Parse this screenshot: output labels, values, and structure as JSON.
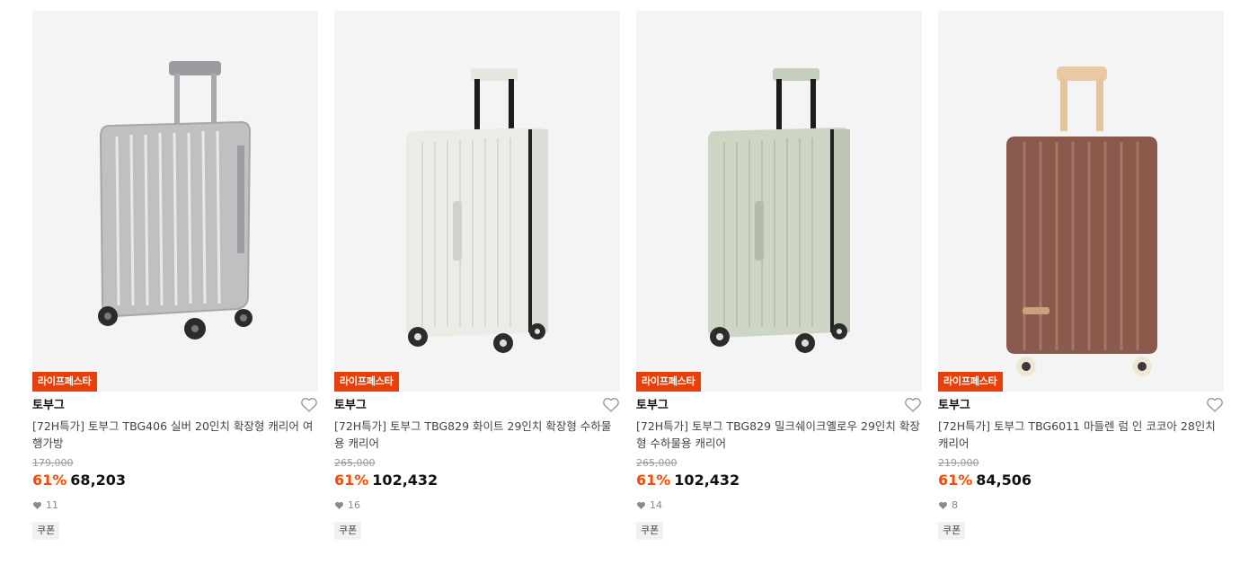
{
  "products": [
    {
      "badge": "라이프페스타",
      "brand": "토부그",
      "title": "[72H특가] 토부그 TBG406 실버 20인치 확장형 캐리어 여행가방",
      "original_price": "179,000",
      "discount": "61%",
      "price": "68,203",
      "likes": "11",
      "coupon": "쿠폰",
      "image_colors": {
        "body": "#b8b9bb",
        "handle": "#8f9194"
      }
    },
    {
      "badge": "라이프페스타",
      "brand": "토부그",
      "title": "[72H특가] 토부그 TBG829 화이트 29인치 확장형 수하물용 캐리어",
      "original_price": "265,000",
      "discount": "61%",
      "price": "102,432",
      "likes": "16",
      "coupon": "쿠폰",
      "image_colors": {
        "body": "#ecebe6",
        "handle": "#f0efea"
      }
    },
    {
      "badge": "라이프페스타",
      "brand": "토부그",
      "title": "[72H특가] 토부그 TBG829 밀크쉐이크옐로우 29인치 확장형 수하물용 캐리어",
      "original_price": "265,000",
      "discount": "61%",
      "price": "102,432",
      "likes": "14",
      "coupon": "쿠폰",
      "image_colors": {
        "body": "#cdd6c5",
        "handle": "#c8d0c0"
      }
    },
    {
      "badge": "라이프페스타",
      "brand": "토부그",
      "title": "[72H특가] 토부그 TBG6011 마들렌 럼 인 코코아 28인치 캐리어",
      "original_price": "219,000",
      "discount": "61%",
      "price": "84,506",
      "likes": "8",
      "coupon": "쿠폰",
      "image_colors": {
        "body": "#8a5a4c",
        "handle": "#e8c9a4"
      }
    }
  ]
}
